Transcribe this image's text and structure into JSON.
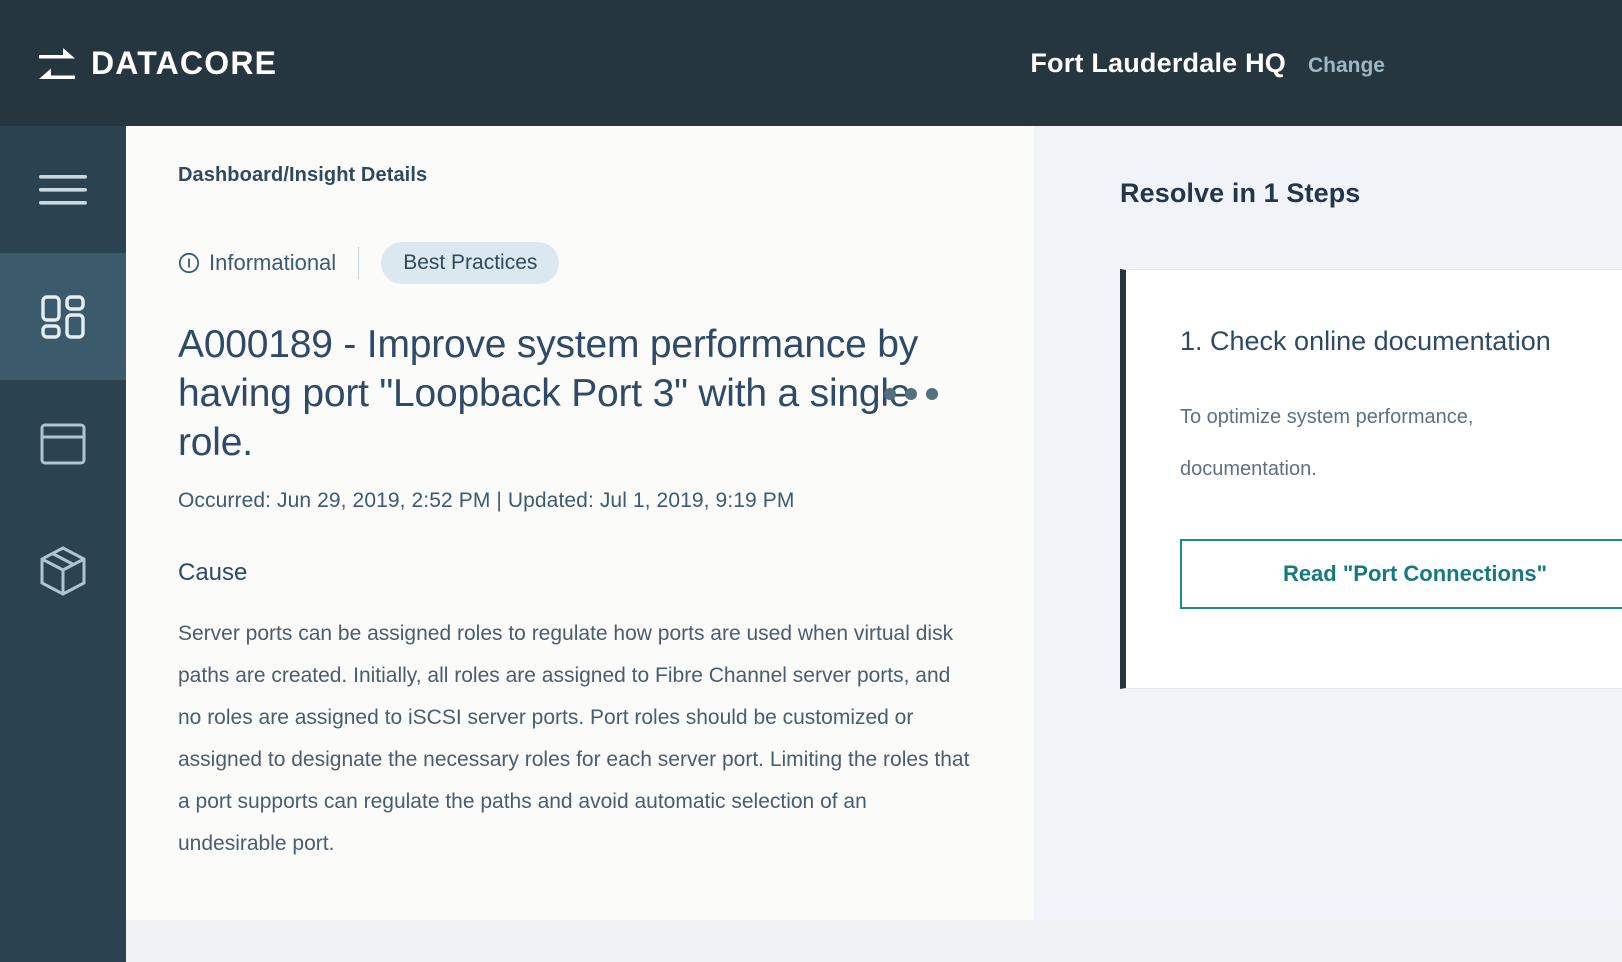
{
  "header": {
    "brand": "DATACORE",
    "brand_icon": "datacore-arrows-logo",
    "site_name": "Fort Lauderdale HQ",
    "change_label": "Change"
  },
  "sidebar": {
    "items": [
      {
        "name": "menu",
        "icon": "hamburger-menu-icon",
        "active": false
      },
      {
        "name": "dashboard",
        "icon": "dashboard-grid-icon",
        "active": true
      },
      {
        "name": "pages",
        "icon": "window-panel-icon",
        "active": false
      },
      {
        "name": "resources",
        "icon": "cube-box-icon",
        "active": false
      }
    ]
  },
  "main": {
    "breadcrumb": "Dashboard/Insight Details",
    "severity_label": "Informational",
    "severity_icon": "info-circle-icon",
    "tag": "Best Practices",
    "overflow_menu_icon": "ellipsis-horizontal-icon",
    "title": "A000189 - Improve system performance by having port \"Loopback Port 3\" with a single role.",
    "timestamps": "Occurred: Jun 29, 2019, 2:52 PM | Updated: Jul 1, 2019, 9:19 PM",
    "cause_heading": "Cause",
    "cause_text": "Server ports can be assigned roles to regulate how ports are used when virtual disk paths are created. Initially, all roles are assigned to Fibre Channel server ports, and no roles are assigned to iSCSI server ports. Port roles should be customized or assigned to designate the necessary roles for each server port. Limiting the roles that a port supports can regulate the paths and avoid automatic selection of an undesirable port."
  },
  "resolve": {
    "title": "Resolve in 1 Steps",
    "steps": [
      {
        "title": "1. Check online documentation",
        "body": "To optimize system performance,\ndocumentation.",
        "button_label": "Read \"Port Connections\""
      }
    ]
  },
  "colors": {
    "header_bg": "#25363f",
    "sidebar_bg": "#2b4250",
    "sidebar_active_bg": "#3b5b6c",
    "left_panel_bg": "#fbfbfa",
    "right_panel_bg": "#f0f4f8",
    "accent_teal": "#17797f",
    "title_navy": "#2f4a66",
    "tag_bg": "#dbe8f0"
  }
}
